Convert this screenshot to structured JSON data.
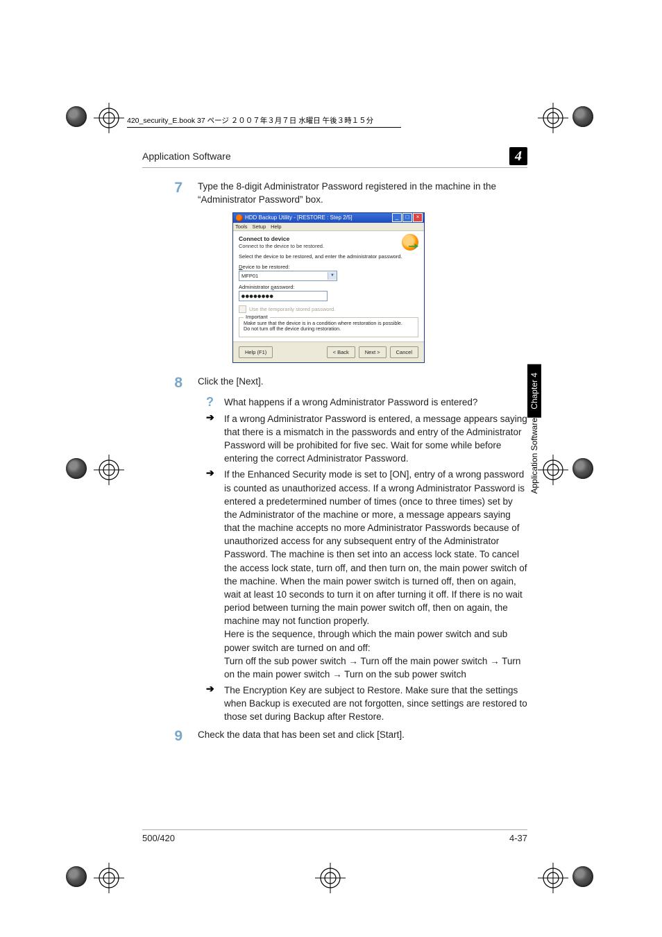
{
  "meta_line": "420_security_E.book 37 ページ ２００７年３月７日 水曜日 午後３時１５分",
  "header": {
    "section": "Application Software",
    "chapter_num": "4"
  },
  "steps": {
    "s7": {
      "num": "7",
      "text": "Type the 8-digit Administrator Password registered in the machine in the “Administrator Password” box."
    },
    "s8": {
      "num": "8",
      "text": "Click the [Next].",
      "q_marker": "?",
      "q": "What happens if a wrong Administrator Password is entered?",
      "a1": "If a wrong Administrator Password is entered, a message appears saying that there is a mismatch in the passwords and entry of the Administrator Password will be prohibited for five sec. Wait for some while before entering the correct Administrator Password.",
      "a2": "If the Enhanced Security mode is set to [ON], entry of a wrong password is counted as unauthorized access. If a wrong Administrator Password is entered a predetermined number of times (once to three times) set by the Administrator of the machine or more, a message appears saying that the machine accepts no more Administrator Passwords because of unauthorized access for any subsequent entry of the Administrator Password. The machine is then set into an access lock state. To cancel the access lock state, turn off, and then turn on, the main power switch of the machine. When the main power switch is turned off, then on again, wait at least 10 seconds to turn it on after turning it off. If there is no wait period between turning the main power switch off, then on again, the machine may not function properly.",
      "a2_seq1": "Here is the sequence, through which the main power switch and sub power switch are turned on and off:",
      "a2_seq2": "Turn off the sub power switch → Turn off the main power switch → Turn on the main power switch → Turn on the sub power switch",
      "a3": "The Encryption Key are subject to Restore. Make sure that the settings when Backup is executed are not forgotten, since settings are restored to those set during Backup after Restore."
    },
    "s9": {
      "num": "9",
      "text": "Check the data that has been set and click [Start]."
    }
  },
  "dialog": {
    "title": "HDD Backup Utility - [RESTORE : Step 2/5]",
    "menu": {
      "tools": "Tools",
      "setup": "Setup",
      "help": "Help"
    },
    "heading": "Connect to device",
    "subheading": "Connect to the device to be restored.",
    "instruction": "Select the device to be restored, and enter the administrator password.",
    "device_label": "Device to be restored:",
    "device_label_ul": "D",
    "device_value": "MFP01",
    "pw_label": "Administrator password:",
    "pw_label_ul": "p",
    "pw_value": "●●●●●●●●",
    "check_label": "Use the temporarily stored password.",
    "check_label_ul": "U",
    "group_legend": "Important",
    "group_msg1": "Make sure that the device is in a condition where restoration is possible.",
    "group_msg2": "Do not turn off the device during restoration.",
    "buttons": {
      "help": "Help (F1)",
      "back": "< Back",
      "next": "Next >",
      "cancel": "Cancel"
    }
  },
  "side": {
    "chapter": "Chapter 4",
    "section": "Application Software"
  },
  "footer": {
    "left": "500/420",
    "right": "4-37"
  }
}
